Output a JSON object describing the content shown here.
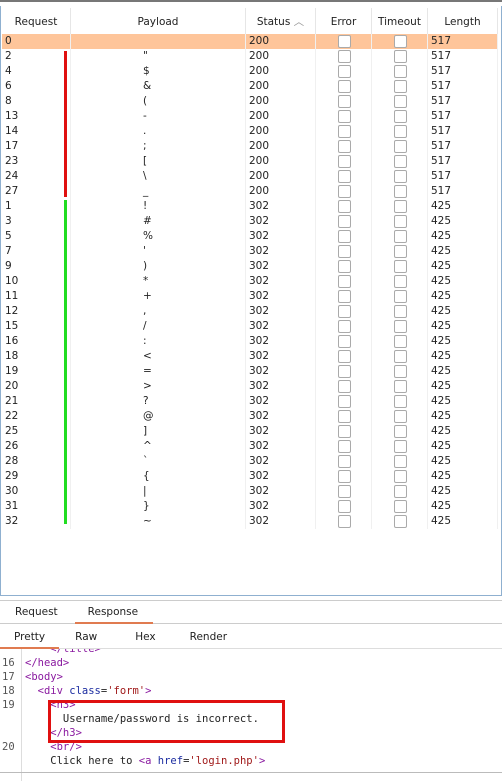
{
  "table": {
    "columns": [
      "Request",
      "Payload",
      "Status",
      "Error",
      "Timeout",
      "Length"
    ],
    "sort_icon": "chevron-up-icon",
    "rows": [
      {
        "request": "0",
        "payload": "",
        "status": "200",
        "length": "517",
        "selected": true
      },
      {
        "request": "2",
        "payload": "\"",
        "status": "200",
        "length": "517",
        "highlight": "red"
      },
      {
        "request": "4",
        "payload": "$",
        "status": "200",
        "length": "517"
      },
      {
        "request": "6",
        "payload": "&",
        "status": "200",
        "length": "517"
      },
      {
        "request": "8",
        "payload": "(",
        "status": "200",
        "length": "517"
      },
      {
        "request": "13",
        "payload": "-",
        "status": "200",
        "length": "517"
      },
      {
        "request": "14",
        "payload": ".",
        "status": "200",
        "length": "517"
      },
      {
        "request": "17",
        "payload": ";",
        "status": "200",
        "length": "517"
      },
      {
        "request": "23",
        "payload": "[",
        "status": "200",
        "length": "517"
      },
      {
        "request": "24",
        "payload": "\\",
        "status": "200",
        "length": "517"
      },
      {
        "request": "27",
        "payload": "_",
        "status": "200",
        "length": "517"
      },
      {
        "request": "1",
        "payload": "!",
        "status": "302",
        "length": "425",
        "highlight": "green"
      },
      {
        "request": "3",
        "payload": "#",
        "status": "302",
        "length": "425"
      },
      {
        "request": "5",
        "payload": "%",
        "status": "302",
        "length": "425"
      },
      {
        "request": "7",
        "payload": "'",
        "status": "302",
        "length": "425"
      },
      {
        "request": "9",
        "payload": ")",
        "status": "302",
        "length": "425"
      },
      {
        "request": "10",
        "payload": "*",
        "status": "302",
        "length": "425"
      },
      {
        "request": "11",
        "payload": "+",
        "status": "302",
        "length": "425"
      },
      {
        "request": "12",
        "payload": ",",
        "status": "302",
        "length": "425"
      },
      {
        "request": "15",
        "payload": "/",
        "status": "302",
        "length": "425"
      },
      {
        "request": "16",
        "payload": ":",
        "status": "302",
        "length": "425"
      },
      {
        "request": "18",
        "payload": "<",
        "status": "302",
        "length": "425"
      },
      {
        "request": "19",
        "payload": "=",
        "status": "302",
        "length": "425"
      },
      {
        "request": "20",
        "payload": ">",
        "status": "302",
        "length": "425"
      },
      {
        "request": "21",
        "payload": "?",
        "status": "302",
        "length": "425"
      },
      {
        "request": "22",
        "payload": "@",
        "status": "302",
        "length": "425"
      },
      {
        "request": "25",
        "payload": "]",
        "status": "302",
        "length": "425"
      },
      {
        "request": "26",
        "payload": "^",
        "status": "302",
        "length": "425"
      },
      {
        "request": "28",
        "payload": "`",
        "status": "302",
        "length": "425"
      },
      {
        "request": "29",
        "payload": "{",
        "status": "302",
        "length": "425"
      },
      {
        "request": "30",
        "payload": "|",
        "status": "302",
        "length": "425"
      },
      {
        "request": "31",
        "payload": "}",
        "status": "302",
        "length": "425"
      },
      {
        "request": "32",
        "payload": "~",
        "status": "302",
        "length": "425"
      }
    ]
  },
  "colors": {
    "selected_row": "#fec59a",
    "red_annotation": "#e01010",
    "green_annotation": "#22dd22",
    "accent": "#e07b50"
  },
  "message_tabs": [
    "Request",
    "Response"
  ],
  "message_tab_active": 1,
  "view_tabs": [
    "Pretty",
    "Raw",
    "Hex",
    "Render"
  ],
  "view_tab_active": 0,
  "code_lines": [
    {
      "n": "",
      "seg": [
        [
          "    ",
          "pl"
        ],
        [
          "</title>",
          "tag"
        ]
      ]
    },
    {
      "n": "16",
      "seg": [
        [
          "</head>",
          "tag"
        ]
      ]
    },
    {
      "n": "17",
      "seg": [
        [
          "<body>",
          "tag"
        ]
      ]
    },
    {
      "n": "18",
      "seg": [
        [
          "  <div ",
          "tag"
        ],
        [
          "class",
          "attr"
        ],
        [
          "=",
          "pl"
        ],
        [
          "'form'",
          "val"
        ],
        [
          ">",
          "tag"
        ]
      ]
    },
    {
      "n": "19",
      "seg": [
        [
          "    <h3>",
          "tag"
        ]
      ]
    },
    {
      "n": "",
      "seg": [
        [
          "      Username/password is incorrect.",
          "pl"
        ]
      ]
    },
    {
      "n": "",
      "seg": [
        [
          "    </h3>",
          "tag"
        ]
      ]
    },
    {
      "n": "20",
      "seg": [
        [
          "    <br/>",
          "tag"
        ]
      ]
    },
    {
      "n": "",
      "seg": [
        [
          "    Click here to ",
          "pl"
        ],
        [
          "<a ",
          "tag"
        ],
        [
          "href",
          "attr"
        ],
        [
          "=",
          "pl"
        ],
        [
          "'login.php'",
          "val"
        ],
        [
          ">",
          "tag"
        ]
      ]
    }
  ]
}
